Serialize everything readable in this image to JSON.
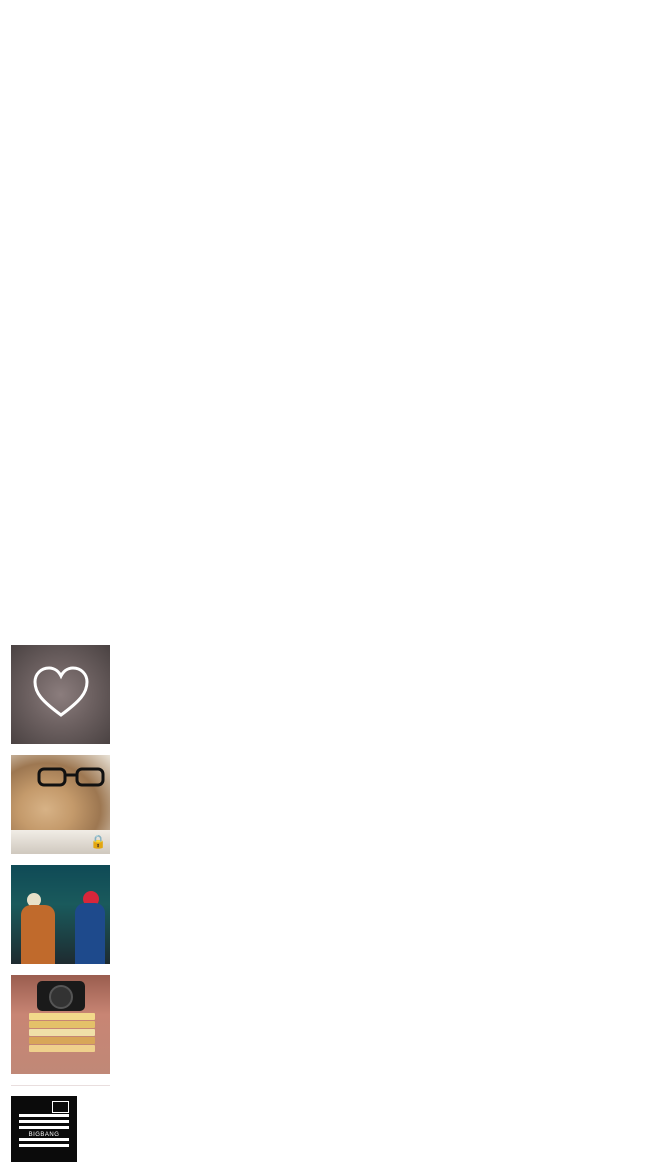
{
  "gallery": {
    "items": [
      {
        "kind": "heart",
        "icon": "heart-outline-icon"
      },
      {
        "kind": "dog-with-glasses",
        "locked": true,
        "icon": "lock-icon"
      },
      {
        "kind": "street-art"
      },
      {
        "kind": "camera-and-books"
      },
      {
        "kind": "partial-thumbnail"
      },
      {
        "kind": "bigbang-album",
        "brand_text": "BIGBANG"
      }
    ]
  },
  "colors": {
    "background": "#ffffff",
    "heart_stroke": "#ffffff",
    "lock": "#ffffff"
  }
}
